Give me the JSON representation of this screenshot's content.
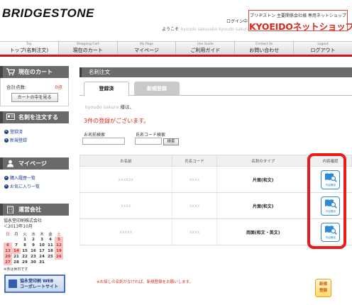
{
  "header": {
    "logo_text": "BRIDGESTONE",
    "login_link": "ログイン中",
    "welcome_prefix": "ようこそ",
    "welcome_name_masked": "kyoudo sakuraba   kyoudo sakura",
    "brand_sub": "ブリヂストン 主要関係会社様 専用ネットショップ",
    "brand_main": "KYOEIDOネットショップ"
  },
  "nav": [
    {
      "en": "Top",
      "jp": "トップ(名刺注文)"
    },
    {
      "en": "Shopping Cart",
      "jp": "現在のカート"
    },
    {
      "en": "My Page",
      "jp": "マイページ"
    },
    {
      "en": "Use Guide",
      "jp": "ご利用ガイド"
    },
    {
      "en": "Contact Us",
      "jp": "お問い合わせ"
    },
    {
      "en": "Logout",
      "jp": "ログアウト"
    }
  ],
  "sidebar": {
    "cart_title": "現在のカート",
    "cart_total_label": "合計点数:",
    "cart_total_value": "0点",
    "cart_view_button": "カートの中を見る",
    "order_title": "名刺を注文する",
    "order_links": [
      "登録済",
      "新規登録"
    ],
    "mypage_title": "マイページ",
    "mypage_links": [
      "購入履歴一覧",
      "お気に入り一覧"
    ],
    "company_title": "運営会社",
    "company_name": "協永堂印刷株式会社",
    "calendar_month": "＜2013年10月",
    "calendar_headers": [
      "日",
      "月",
      "火",
      "水",
      "木",
      "金",
      "土"
    ],
    "calendar_rows": [
      [
        "",
        "",
        "1",
        "2",
        "3",
        "4",
        "5"
      ],
      [
        "6",
        "7",
        "8",
        "9",
        "10",
        "11",
        "12"
      ],
      [
        "13",
        "14",
        "15",
        "16",
        "17",
        "18",
        "19"
      ],
      [
        "20",
        "21",
        "22",
        "23",
        "24",
        "25",
        "26"
      ],
      [
        "27",
        "28",
        "29",
        "30",
        "31",
        "",
        ""
      ]
    ],
    "calendar_note": "※赤は休日です",
    "banner_line1": "協永堂印刷 WEB",
    "banner_line2": "コーポレートサイト"
  },
  "main": {
    "page_title": "名刺注文",
    "tabs": [
      "登録済",
      "新規登録"
    ],
    "customer_name_masked": "kyoudo sakura",
    "customer_suffix": "様は、",
    "count_message": "3件の登録がございます。",
    "search_name_label": "お名前検索",
    "search_code_label": "氏名コード検索",
    "search_name_value": "",
    "search_code_value": "",
    "search_button": "検索",
    "table_headers": [
      "お名前",
      "氏名コード",
      "名刺のタイプ",
      "内容確認"
    ],
    "rows": [
      {
        "name": "xxxxxx",
        "code": "xxxx",
        "type": "片面(和文)"
      },
      {
        "name": "xxxx",
        "code": "xxxx",
        "type": "片面(和文)"
      },
      {
        "name": "xxxxx",
        "code": "xxxx",
        "type": "両面(和文・英文)"
      }
    ],
    "view_icon_label": "内容確認",
    "footer_note": "※お探しの名刺がなければ、新規登録をお願いします。",
    "new_register_button_line1": "新規",
    "new_register_button_line2": "登録"
  },
  "colors": {
    "accent_red": "#d8291f",
    "nav_border_red": "#c8161d",
    "link_blue": "#1a3f8a",
    "icon_blue": "#2f8ad6",
    "highlight_red": "#ea1a1a"
  }
}
